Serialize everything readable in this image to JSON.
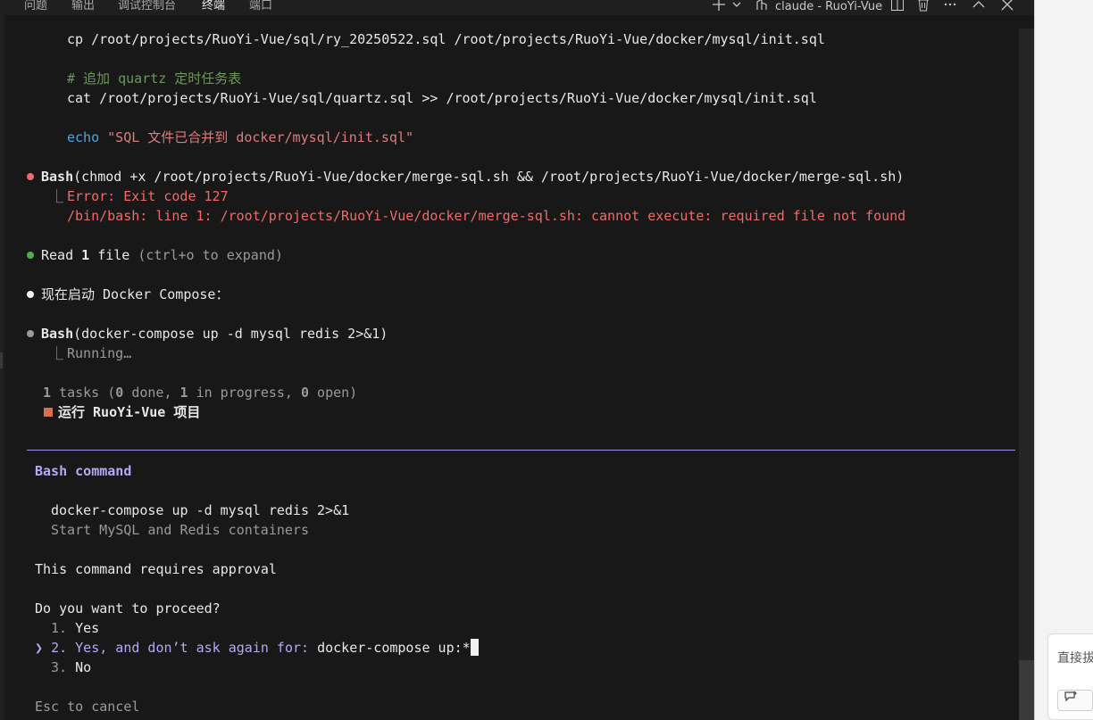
{
  "panel": {
    "tabs": [
      "问题",
      "输出",
      "调试控制台",
      "终端",
      "端口"
    ],
    "active_tab": "终端",
    "terminal_name": "claude - RuoYi-Vue",
    "icons": [
      "plus-icon",
      "chevron-down-icon",
      "terminal-icon",
      "split-icon",
      "trash-icon",
      "more-icon",
      "chevron-up-icon",
      "close-icon"
    ]
  },
  "script": {
    "cp_line": "cp /root/projects/RuoYi-Vue/sql/ry_20250522.sql /root/projects/RuoYi-Vue/docker/mysql/init.sql",
    "comment_line": "# 追加 quartz 定时任务表",
    "cat_line": "cat /root/projects/RuoYi-Vue/sql/quartz.sql >> /root/projects/RuoYi-Vue/docker/mysql/init.sql",
    "echo_cmd": "echo",
    "echo_str": "\"SQL 文件已合并到 docker/mysql/init.sql\""
  },
  "bash1": {
    "tool": "Bash",
    "args": "(chmod +x /root/projects/RuoYi-Vue/docker/merge-sql.sh && /root/projects/RuoYi-Vue/docker/merge-sql.sh)",
    "error1": "Error: Exit code 127",
    "error2": "/bin/bash: line 1: /root/projects/RuoYi-Vue/docker/merge-sql.sh: cannot execute: required file not found"
  },
  "read": {
    "prefix": "Read ",
    "count": "1",
    "suffix": " file",
    "hint": " (ctrl+o to expand)"
  },
  "message": "现在启动 Docker Compose：",
  "bash2": {
    "tool": "Bash",
    "args": "(docker-compose up -d mysql redis 2>&1)",
    "status": "Running…"
  },
  "tasks": {
    "count": "1",
    "label_a": " tasks (",
    "done": "0",
    "label_b": " done, ",
    "in_progress": "1",
    "label_c": " in progress, ",
    "open": "0",
    "label_d": " open)",
    "item": "运行 RuoYi-Vue 项目"
  },
  "prompt": {
    "title": "Bash command",
    "command": "docker-compose up -d mysql redis 2>&1",
    "description": "Start MySQL and Redis containers",
    "approval": "This command requires approval",
    "question": "Do you want to proceed?",
    "options": [
      "1. Yes",
      "2. Yes, and don’t ask again for: ",
      "3. No"
    ],
    "option2_value": "docker-compose up:*",
    "selector": "❯",
    "cancel_hint": "Esc to cancel"
  },
  "colors": {
    "error": "#f06a6a",
    "success_dot": "#4caf50",
    "accent": "#b9a7f5",
    "task_square": "#d7714d"
  },
  "side_panel": {
    "text": "直接拔"
  }
}
